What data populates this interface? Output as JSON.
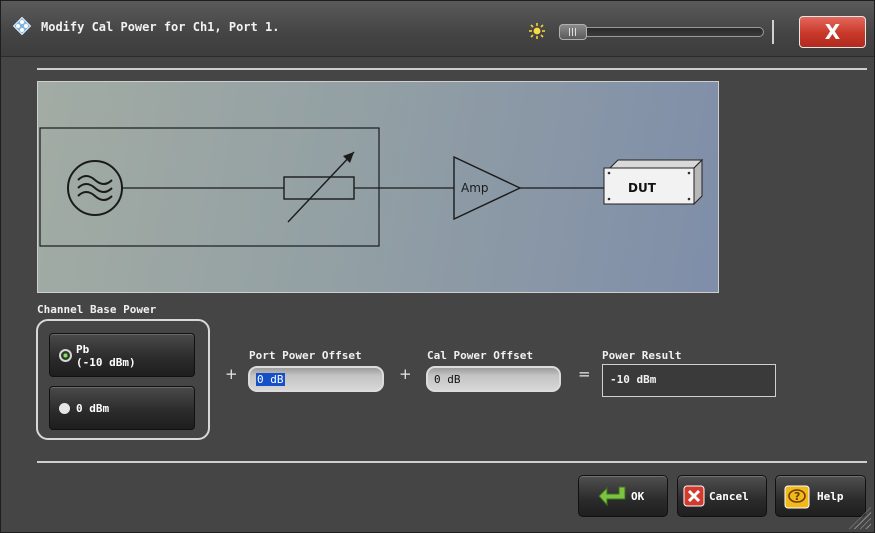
{
  "window": {
    "title": "Modify Cal Power for Ch1, Port 1.",
    "close_label": "X"
  },
  "diagram": {
    "amp_label": "Amp",
    "dut_label": "DUT"
  },
  "channel_base_power": {
    "label": "Channel Base Power",
    "options": [
      {
        "label": "Pb\n(-10 dBm)",
        "selected": true
      },
      {
        "label": "0 dBm",
        "selected": false
      }
    ]
  },
  "operators": {
    "plus": "+",
    "equals": "="
  },
  "port_power_offset": {
    "label": "Port Power Offset",
    "value": "0 dB"
  },
  "cal_power_offset": {
    "label": "Cal Power Offset",
    "value": "0 dB"
  },
  "power_result": {
    "label": "Power Result",
    "value": "-10 dBm"
  },
  "buttons": {
    "ok": "OK",
    "cancel": "Cancel",
    "help": "Help"
  },
  "icons": {
    "app": "rohde-schwarz-diamond-icon",
    "brightness": "sun-icon",
    "ok": "green-arrow-icon",
    "cancel": "red-x-icon",
    "help": "yellow-question-icon"
  }
}
